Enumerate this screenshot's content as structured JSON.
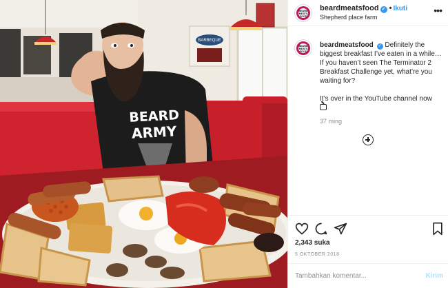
{
  "post": {
    "username": "beardmeatsfood",
    "follow_label": "Ikuti",
    "location": "Shepherd place farm",
    "more_label": "•••",
    "avatar_text": [
      "BEARD",
      "MEATS",
      "FOOD"
    ],
    "caption_p1": "Definitely the biggest breakfast I’ve eaten in a while… If you haven’t seen The Terminator 2 Breakfast Challenge yet, what’re you waiting for?",
    "caption_p2": "It’s over in the YouTube channel now",
    "time_ago": "37 ming",
    "likes": "2,343 suka",
    "date": "5 OKTOBER 2018",
    "comment_placeholder": "Tambahkan komentar...",
    "send_label": "Kirim"
  },
  "photo": {
    "shirt_text_line1": "BEARD",
    "shirt_text_line2": "ARMY",
    "sign_text": "BARBEQUE"
  },
  "icons": [
    "heart-icon",
    "comment-icon",
    "share-icon",
    "bookmark-icon",
    "tv-icon",
    "plus-circle-icon",
    "verified-icon",
    "more-icon"
  ],
  "colors": {
    "link_blue": "#3897f0",
    "send_disabled": "#b2dffc",
    "muted_text": "#8e8e8e",
    "booth_red": "#c8202a"
  }
}
